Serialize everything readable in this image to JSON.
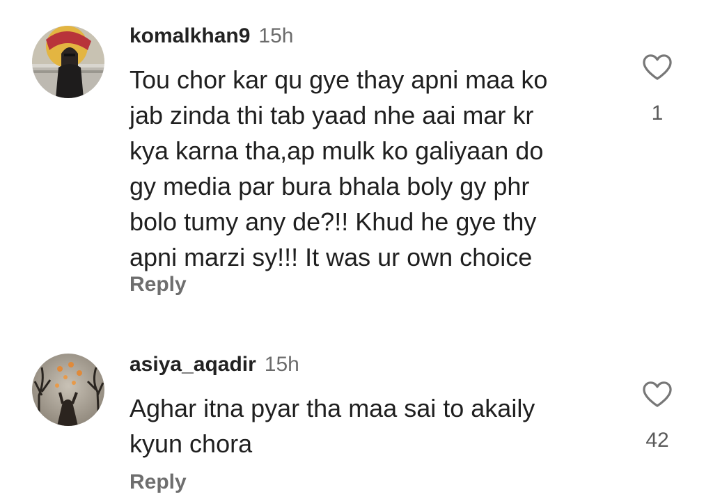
{
  "comments": [
    {
      "username": "komalkhan9",
      "time": "15h",
      "lines": [
        "Tou chor kar qu gye thay apni maa ko",
        "jab zinda thi tab yaad nhe aai mar kr",
        "kya karna tha,ap mulk ko galiyaan do",
        "gy media par bura bhala boly gy phr",
        "bolo tumy any de?!! Khud he gye thy",
        "apni marzi sy!!! It was ur own choice"
      ],
      "reply_label": "Reply",
      "like_count": "1",
      "like_icon": "heart-outline-icon"
    },
    {
      "username": "asiya_aqadir",
      "time": "15h",
      "lines": [
        "Aghar itna pyar tha maa sai to akaily",
        "kyun chora"
      ],
      "reply_label": "Reply",
      "like_count": "42",
      "like_icon": "heart-outline-icon"
    }
  ]
}
